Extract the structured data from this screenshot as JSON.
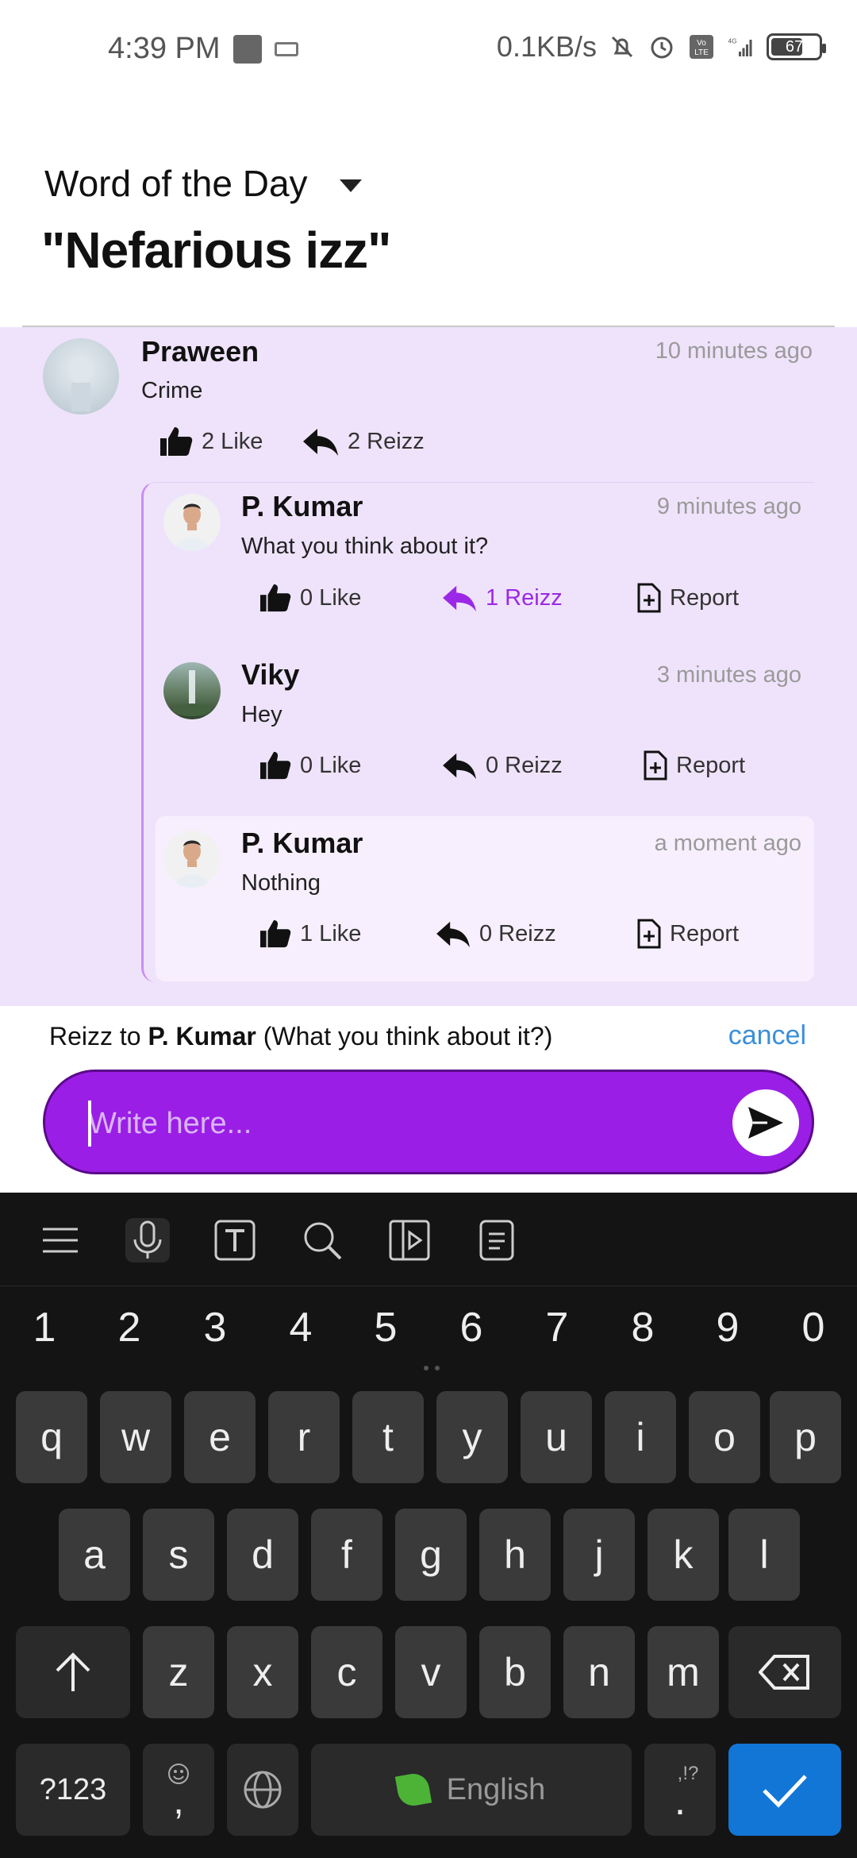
{
  "status_bar": {
    "time": "4:39 PM",
    "net_speed": "0.1KB/s",
    "battery": "67",
    "network": "4G",
    "volte": "Vo LTE"
  },
  "header": {
    "title": "Word of the Day",
    "word": "\"Nefarious izz\""
  },
  "thread": {
    "main": {
      "name": "Praween",
      "time": "10 minutes ago",
      "text": "Crime",
      "like_label": "2 Like",
      "reizz_label": "2 Reizz"
    },
    "replies": [
      {
        "name": "P. Kumar",
        "time": "9 minutes ago",
        "text": "What you think about it?",
        "like_label": "0 Like",
        "reizz_label": "1 Reizz",
        "report_label": "Report"
      },
      {
        "name": "Viky",
        "time": "3 minutes ago",
        "text": "Hey",
        "like_label": "0 Like",
        "reizz_label": "0 Reizz",
        "report_label": "Report"
      },
      {
        "name": "P. Kumar",
        "time": "a moment ago",
        "text": "Nothing",
        "like_label": "1 Like",
        "reizz_label": "0 Reizz",
        "report_label": "Report"
      }
    ]
  },
  "composer": {
    "reply_prefix": "Reizz to ",
    "reply_name": "P. Kumar",
    "reply_context": " (What you think about it?)",
    "cancel_label": "cancel",
    "placeholder": "Write here..."
  },
  "keyboard": {
    "numbers": [
      "1",
      "2",
      "3",
      "4",
      "5",
      "6",
      "7",
      "8",
      "9",
      "0"
    ],
    "row1": [
      "q",
      "w",
      "e",
      "r",
      "t",
      "y",
      "u",
      "i",
      "o",
      "p"
    ],
    "row2": [
      "a",
      "s",
      "d",
      "f",
      "g",
      "h",
      "j",
      "k",
      "l"
    ],
    "row3": [
      "z",
      "x",
      "c",
      "v",
      "b",
      "n",
      "m"
    ],
    "symbols_label": "?123",
    "comma_label": ",",
    "space_label": "English",
    "period_label": ".",
    "period_hint": ",!?"
  },
  "colors": {
    "accent": "#9b1ee6",
    "thread_bg": "#efe3fb",
    "link": "#3b8fd9",
    "keyboard_bg": "#141414",
    "enter_key": "#1276d6"
  }
}
